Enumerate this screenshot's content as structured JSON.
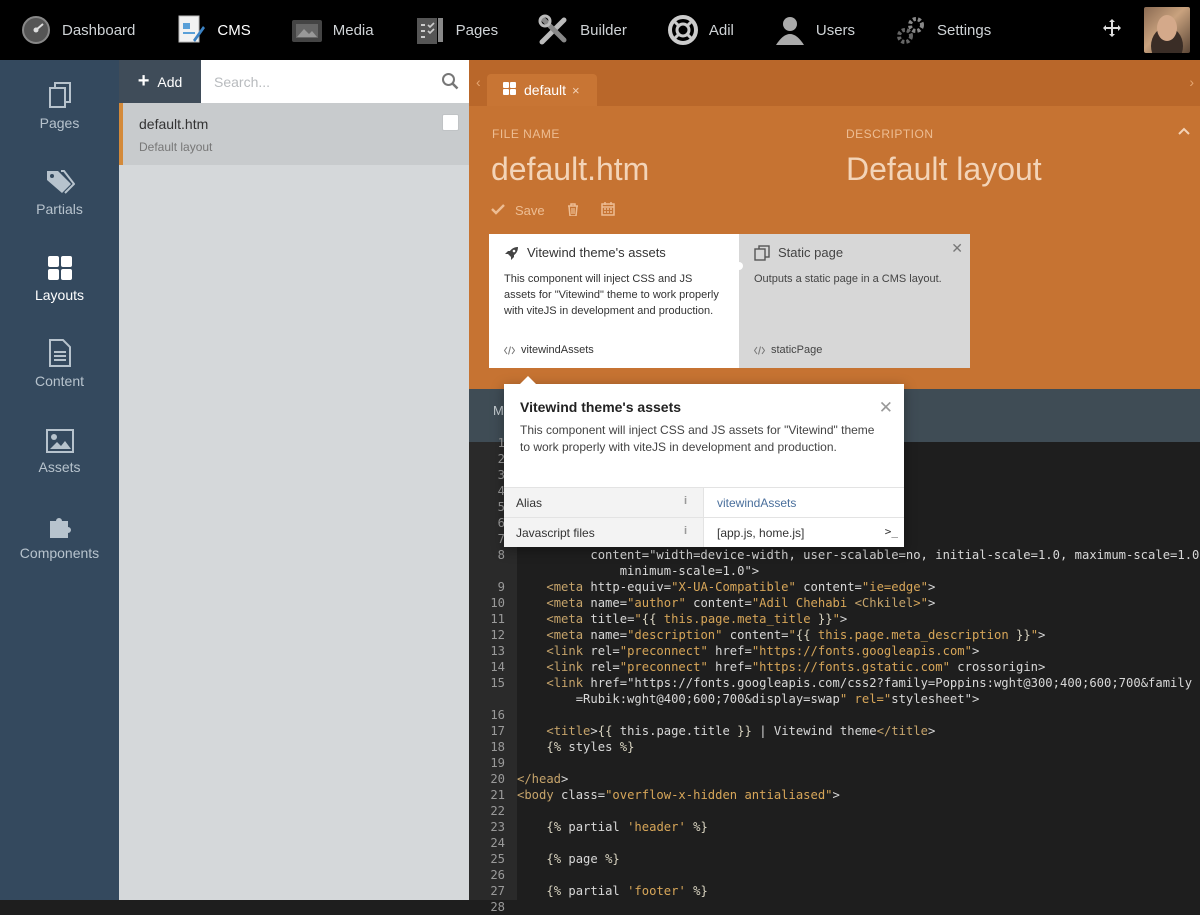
{
  "topnav": {
    "items": [
      {
        "label": "Dashboard",
        "icon": "dashboard-icon"
      },
      {
        "label": "CMS",
        "icon": "cms-icon"
      },
      {
        "label": "Media",
        "icon": "media-icon"
      },
      {
        "label": "Pages",
        "icon": "pages-icon"
      },
      {
        "label": "Builder",
        "icon": "builder-icon"
      },
      {
        "label": "Adil",
        "icon": "lifebuoy-icon"
      },
      {
        "label": "Users",
        "icon": "users-icon"
      },
      {
        "label": "Settings",
        "icon": "settings-icon"
      }
    ],
    "active": "CMS"
  },
  "sidebar": {
    "items": [
      {
        "label": "Pages",
        "icon": "pages-icon"
      },
      {
        "label": "Partials",
        "icon": "tags-icon"
      },
      {
        "label": "Layouts",
        "icon": "grid-icon"
      },
      {
        "label": "Content",
        "icon": "file-icon"
      },
      {
        "label": "Assets",
        "icon": "image-icon"
      },
      {
        "label": "Components",
        "icon": "puzzle-icon"
      }
    ],
    "active": "Layouts"
  },
  "list": {
    "add_label": "Add",
    "search_placeholder": "Search...",
    "items": [
      {
        "title": "default.htm",
        "subtitle": "Default layout"
      }
    ]
  },
  "editor": {
    "tab_label": "default",
    "file_name_label": "FILE NAME",
    "file_name_value": "default.htm",
    "description_label": "DESCRIPTION",
    "description_value": "Default layout",
    "save_label": "Save",
    "components": [
      {
        "title": "Vitewind theme's assets",
        "description": "This component will inject CSS and JS assets for \"Vitewind\" theme to work properly with viteJS in development and production.",
        "alias": "vitewindAssets"
      },
      {
        "title": "Static page",
        "description": "Outputs a static page in a CMS layout.",
        "alias": "staticPage"
      }
    ],
    "markup_label": "M"
  },
  "popover": {
    "title": "Vitewind theme's assets",
    "description": "This component will inject CSS and JS assets for \"Vitewind\" theme to work properly with viteJS in development and production.",
    "properties": [
      {
        "name": "Alias",
        "value": "vitewindAssets"
      },
      {
        "name": "Javascript files",
        "value": "[app.js, home.js]"
      }
    ]
  },
  "code": {
    "line_numbers": [
      "1",
      "2",
      "3",
      "4",
      "5",
      "6",
      "7",
      "8",
      "",
      "9",
      "10",
      "11",
      "12",
      "13",
      "14",
      "15",
      "",
      "16",
      "17",
      "18",
      "19",
      "20",
      "21",
      "22",
      "23",
      "24",
      "25",
      "26",
      "27",
      "28"
    ],
    "lines": [
      "",
      "",
      "",
      "",
      "",
      "",
      "",
      "          content=\"width=device-width, user-scalable=no, initial-scale=1.0, maximum-scale=1.0,",
      "              minimum-scale=1.0\">",
      "    <meta http-equiv=\"X-UA-Compatible\" content=\"ie=edge\">",
      "    <meta name=\"author\" content=\"Adil Chehabi <Chkilel>\">",
      "    <meta title=\"{{ this.page.meta_title }}\">",
      "    <meta name=\"description\" content=\"{{ this.page.meta_description }}\">",
      "    <link rel=\"preconnect\" href=\"https://fonts.googleapis.com\">",
      "    <link rel=\"preconnect\" href=\"https://fonts.gstatic.com\" crossorigin>",
      "    <link href=\"https://fonts.googleapis.com/css2?family=Poppins:wght@300;400;600;700&family",
      "        =Rubik:wght@400;600;700&display=swap\" rel=\"stylesheet\">",
      "",
      "    <title>{{ this.page.title }} | Vitewind theme</title>",
      "    {% styles %}",
      "",
      "</head>",
      "<body class=\"overflow-x-hidden antialiased\">",
      "",
      "    {% partial 'header' %}",
      "",
      "    {% page %}",
      "",
      "    {% partial 'footer' %}",
      ""
    ]
  }
}
